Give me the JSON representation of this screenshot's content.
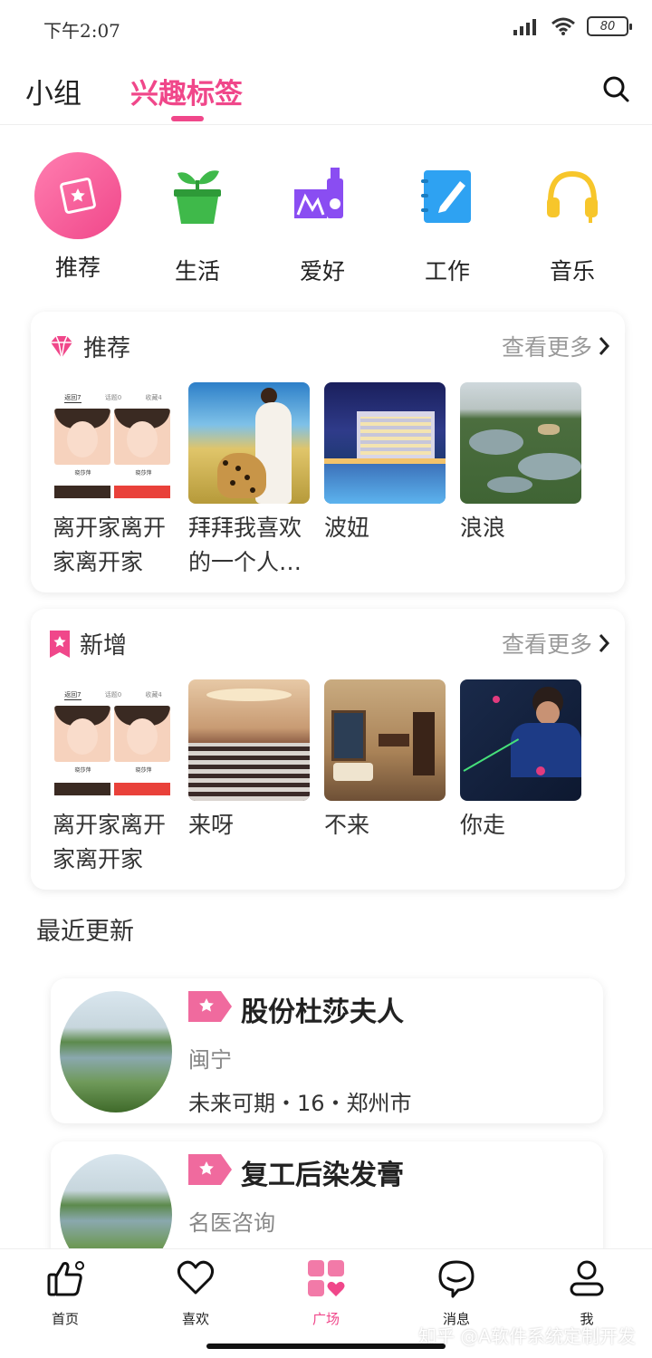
{
  "status_bar": {
    "time": "下午2:07",
    "battery": "80"
  },
  "top_tabs": [
    {
      "label": "小组"
    },
    {
      "label": "兴趣标签"
    }
  ],
  "categories": [
    {
      "label": "推荐",
      "icon": "recommend-card-icon"
    },
    {
      "label": "生活",
      "icon": "plant-pot-icon"
    },
    {
      "label": "爱好",
      "icon": "hobby-camera-icon"
    },
    {
      "label": "工作",
      "icon": "notebook-pen-icon"
    },
    {
      "label": "音乐",
      "icon": "headphones-icon"
    }
  ],
  "sections": {
    "recommend": {
      "title": "推荐",
      "more": "查看更多",
      "items": [
        {
          "title": "离开家离开家离开家",
          "thumb": "app-screenshot"
        },
        {
          "title": "拜拜我喜欢的一个人…",
          "thumb": "woman-with-cheetah"
        },
        {
          "title": "波妞",
          "thumb": "hotel-night"
        },
        {
          "title": "浪浪",
          "thumb": "wetland-aerial"
        }
      ]
    },
    "new": {
      "title": "新增",
      "more": "查看更多",
      "items": [
        {
          "title": "离开家离开家离开家",
          "thumb": "app-screenshot"
        },
        {
          "title": "来呀",
          "thumb": "conference-hall"
        },
        {
          "title": "不来",
          "thumb": "hotel-room"
        },
        {
          "title": "你走",
          "thumb": "boy-with-yoyo"
        }
      ]
    }
  },
  "thumb_texts": {
    "tab_a": "返回7",
    "tab_b": "话题0",
    "tab_c": "收藏4",
    "user": "晓莎萍"
  },
  "recent": {
    "title": "最近更新",
    "posts": [
      {
        "title": "股份杜莎夫人",
        "subtitle": "闽宁",
        "meta": "未来可期・16・郑州市"
      },
      {
        "title": "复工后染发膏",
        "subtitle": "名医咨询",
        "meta": ""
      }
    ]
  },
  "bottom_nav": [
    {
      "label": "首页",
      "icon": "thumbs-up-icon"
    },
    {
      "label": "喜欢",
      "icon": "heart-icon"
    },
    {
      "label": "广场",
      "icon": "plaza-grid-icon",
      "active": true
    },
    {
      "label": "消息",
      "icon": "chat-bubble-icon"
    },
    {
      "label": "我",
      "icon": "user-icon"
    }
  ],
  "watermark": "知乎 @A软件系统定制开发",
  "colors": {
    "accent": "#f0478a",
    "life_green": "#3fb94a",
    "hobby_purple": "#8a4df2",
    "work_blue": "#2ea2f2",
    "music_yellow": "#f7c62b"
  }
}
